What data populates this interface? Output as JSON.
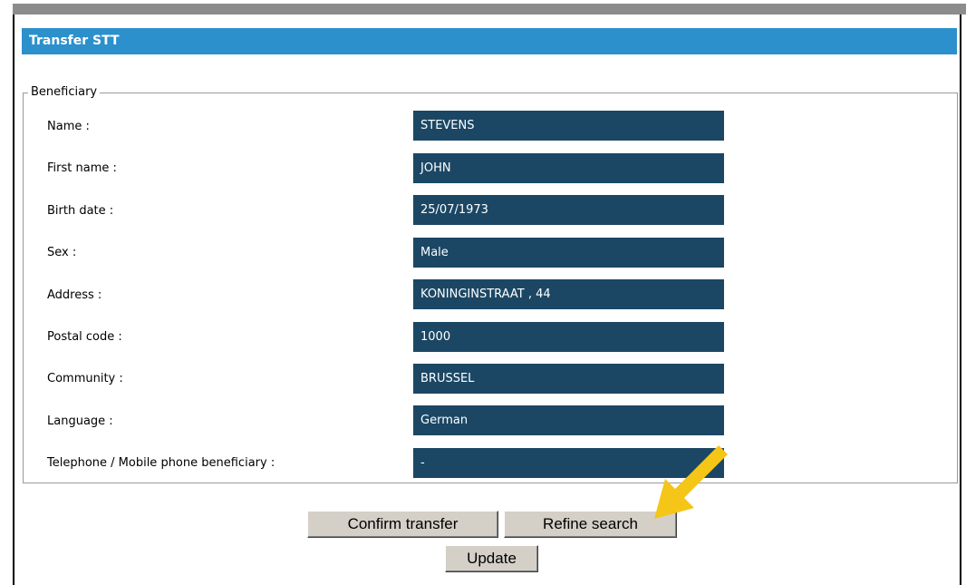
{
  "header": {
    "title": "Transfer STT"
  },
  "beneficiary": {
    "legend": "Beneficiary",
    "fields": [
      {
        "label": "Name :",
        "value": "STEVENS"
      },
      {
        "label": "First name :",
        "value": "JOHN"
      },
      {
        "label": "Birth date :",
        "value": "25/07/1973"
      },
      {
        "label": "Sex :",
        "value": "Male"
      },
      {
        "label": "Address :",
        "value": "KONINGINSTRAAT , 44"
      },
      {
        "label": "Postal code :",
        "value": "1000"
      },
      {
        "label": "Community :",
        "value": "BRUSSEL"
      },
      {
        "label": "Language :",
        "value": "German"
      },
      {
        "label": "Telephone / Mobile phone beneficiary :",
        "value": "-"
      }
    ]
  },
  "actions": {
    "confirm_label": "Confirm transfer",
    "refine_label": "Refine search",
    "update_label": "Update"
  },
  "colors": {
    "header_bg": "#2b90cc",
    "value_bg": "#1b4764",
    "arrow": "#f5c518"
  },
  "annotation": {
    "icon": "yellow-arrow-icon"
  }
}
